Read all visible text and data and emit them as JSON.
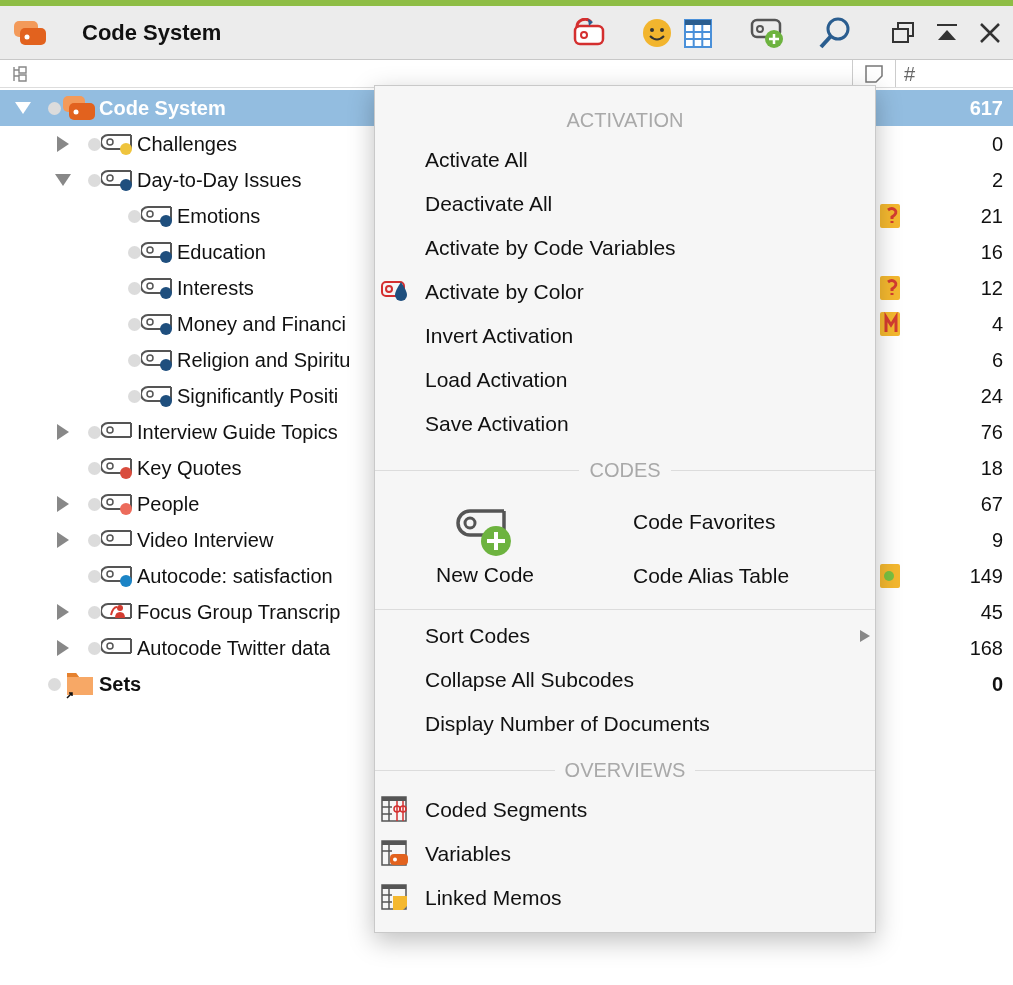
{
  "window": {
    "title": "Code System"
  },
  "columns": {
    "count_header": "#"
  },
  "tree": [
    {
      "kind": "root",
      "label": "Code System",
      "count": "617",
      "selected": true,
      "expanded": true,
      "activated": false,
      "children": [
        {
          "kind": "code",
          "label": "Challenges",
          "count": "0",
          "color": "#efc43d",
          "selected": false,
          "expanded": false,
          "activated": false
        },
        {
          "kind": "code",
          "label": "Day-to-Day Issues",
          "count": "2",
          "color": "#1f4f7e",
          "selected": false,
          "expanded": true,
          "activated": false,
          "children": [
            {
              "kind": "code",
              "label": "Emotions",
              "count": "21",
              "color": "#1f4f7e",
              "memo": {
                "kind": "question"
              },
              "selected": false,
              "activated": false
            },
            {
              "kind": "code",
              "label": "Education",
              "count": "16",
              "color": "#1f4f7e",
              "selected": false,
              "activated": false
            },
            {
              "kind": "code",
              "label": "Interests",
              "count": "12",
              "color": "#1f4f7e",
              "memo": {
                "kind": "question"
              },
              "selected": false,
              "activated": false
            },
            {
              "kind": "code",
              "label": "Money and Financi",
              "count": "4",
              "color": "#1f4f7e",
              "memo": {
                "kind": "letter"
              },
              "selected": false,
              "activated": false
            },
            {
              "kind": "code",
              "label": "Religion and Spiritu",
              "count": "6",
              "color": "#1f4f7e",
              "selected": false,
              "activated": false
            },
            {
              "kind": "code",
              "label": "Significantly Positi",
              "count": "24",
              "color": "#1f4f7e",
              "selected": false,
              "activated": false
            }
          ]
        },
        {
          "kind": "code",
          "label": "Interview Guide Topics",
          "count": "76",
          "selected": false,
          "expanded": false,
          "activated": false
        },
        {
          "kind": "code",
          "label": "Key Quotes",
          "count": "18",
          "color": "#d94c3d",
          "selected": false,
          "activated": false
        },
        {
          "kind": "code",
          "label": "People",
          "count": "67",
          "color": "#ec6b5b",
          "selected": false,
          "expanded": false,
          "activated": false
        },
        {
          "kind": "code",
          "label": "Video Interview",
          "count": "9",
          "selected": false,
          "expanded": false,
          "activated": false
        },
        {
          "kind": "code",
          "label": "Autocode: satisfaction",
          "count": "149",
          "color": "#1b84c6",
          "memo": {
            "kind": "dot"
          },
          "selected": false,
          "activated": false
        },
        {
          "kind": "focus",
          "label": "Focus Group Transcrip",
          "count": "45",
          "selected": false,
          "expanded": false,
          "activated": false
        },
        {
          "kind": "code",
          "label": "Autocode Twitter data",
          "count": "168",
          "selected": false,
          "expanded": false,
          "activated": false
        }
      ]
    },
    {
      "kind": "sets",
      "label": "Sets",
      "count": "0",
      "selected": false,
      "activated": false
    }
  ],
  "context_menu": {
    "sections": [
      {
        "header": "ACTIVATION",
        "items": [
          {
            "label": "Activate All",
            "submenu": false
          },
          {
            "label": "Deactivate All",
            "submenu": false
          },
          {
            "label": "Activate by Code Variables",
            "submenu": false
          },
          {
            "label": "Activate by Color",
            "kind": "color",
            "submenu": false
          },
          {
            "label": "Invert Activation",
            "submenu": false
          },
          {
            "label": "Load Activation",
            "submenu": false
          },
          {
            "label": "Save Activation",
            "submenu": false
          }
        ]
      },
      {
        "header": "CODES",
        "feature": {
          "label": "New Code"
        },
        "side_items": [
          {
            "label": "Code Favorites"
          },
          {
            "label": "Code Alias Table"
          }
        ],
        "items": [
          {
            "label": "Sort Codes",
            "submenu": true
          },
          {
            "label": "Collapse All Subcodes",
            "submenu": false
          },
          {
            "label": "Display Number of Documents",
            "submenu": false
          }
        ]
      },
      {
        "header": "OVERVIEWS",
        "items": [
          {
            "label": "Coded Segments",
            "kind": "segments",
            "submenu": false
          },
          {
            "label": "Variables",
            "kind": "variables",
            "submenu": false
          },
          {
            "label": "Linked Memos",
            "kind": "memos",
            "submenu": false
          }
        ]
      }
    ]
  }
}
